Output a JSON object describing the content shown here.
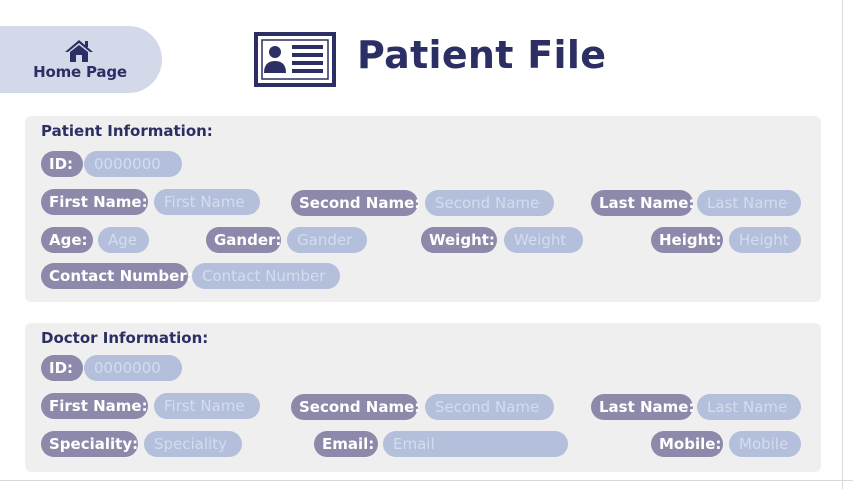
{
  "nav": {
    "home_label": "Home Page"
  },
  "page": {
    "title": "Patient File"
  },
  "patient": {
    "heading": "Patient Information:",
    "id_label": "ID:",
    "id_placeholder": "0000000",
    "first_name_label": "First Name:",
    "first_name_placeholder": "First Name",
    "second_name_label": "Second Name:",
    "second_name_placeholder": "Second Name",
    "last_name_label": "Last Name:",
    "last_name_placeholder": "Last Name",
    "age_label": "Age:",
    "age_placeholder": "Age",
    "gender_label": "Gander:",
    "gender_placeholder": "Gander",
    "weight_label": "Weight:",
    "weight_placeholder": "Weight",
    "height_label": "Height:",
    "height_placeholder": "Height",
    "contact_label": "Contact Number:",
    "contact_placeholder": "Contact Number"
  },
  "doctor": {
    "heading": "Doctor Information:",
    "id_label": "ID:",
    "id_placeholder": "0000000",
    "first_name_label": "First Name:",
    "first_name_placeholder": "First Name",
    "second_name_label": "Second Name:",
    "second_name_placeholder": "Second Name",
    "last_name_label": "Last Name:",
    "last_name_placeholder": "Last Name",
    "speciality_label": "Speciality:",
    "speciality_placeholder": "Speciality",
    "email_label": "Email:",
    "email_placeholder": "Email",
    "mobile_label": "Mobile:",
    "mobile_placeholder": "Mobile"
  },
  "colors": {
    "accent": "#2b2f63",
    "label_pill": "#8c89aa",
    "input_pill": "#b3bfdb",
    "panel": "#efefef",
    "home_button": "#d3d9e8"
  },
  "icons": {
    "home": "home-icon",
    "title": "id-card-icon"
  }
}
